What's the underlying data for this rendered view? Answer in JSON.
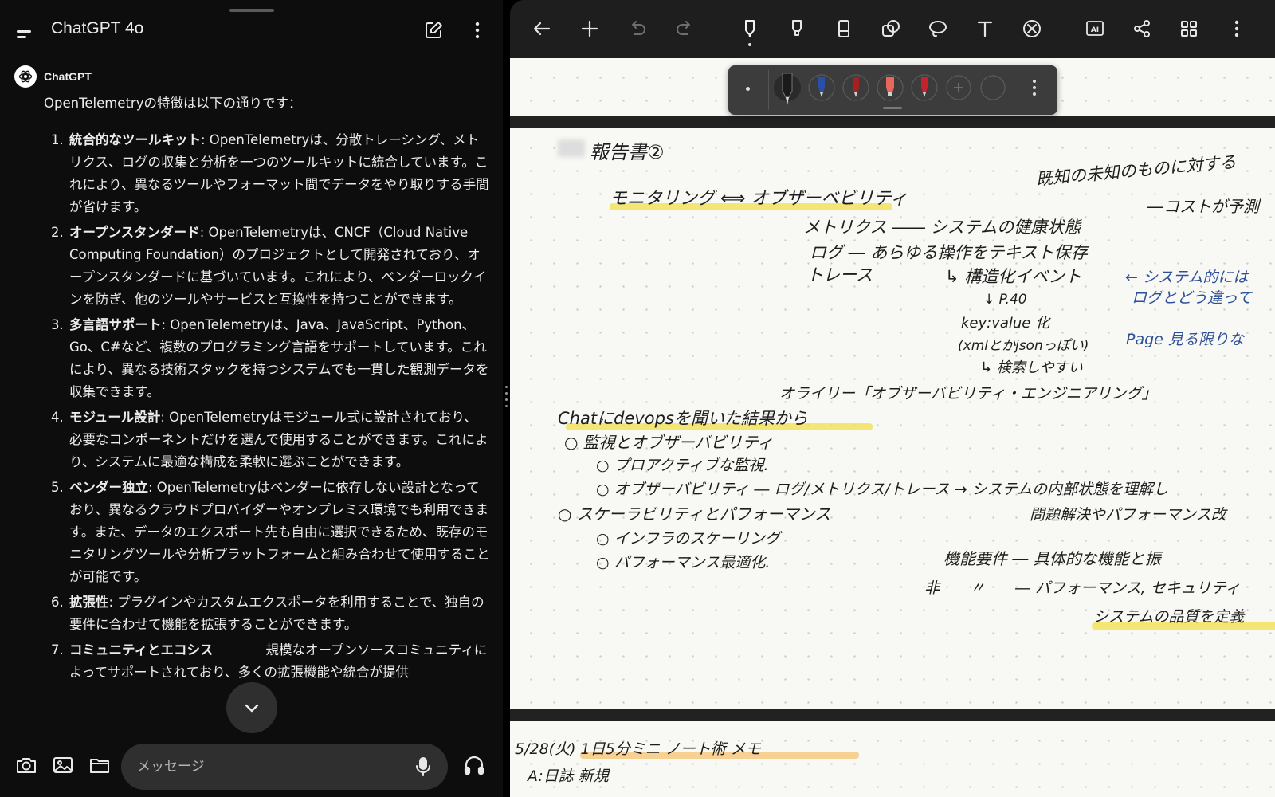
{
  "chat": {
    "title": "ChatGPT 4o",
    "assistant_name": "ChatGPT",
    "intro": "OpenTelemetryの特徴は以下の通りです：",
    "features": [
      {
        "num": "1.",
        "title": "統合的なツールキット",
        "text": ": OpenTelemetryは、分散トレーシング、メトリクス、ログの収集と分析を一つのツールキットに統合しています。これにより、異なるツールやフォーマット間でデータをやり取りする手間が省けます。"
      },
      {
        "num": "2.",
        "title": "オープンスタンダード",
        "text": ": OpenTelemetryは、CNCF（Cloud Native Computing Foundation）のプロジェクトとして開発されており、オープンスタンダードに基づいています。これにより、ベンダーロックインを防ぎ、他のツールやサービスと互換性を持つことができます。"
      },
      {
        "num": "3.",
        "title": "多言語サポート",
        "text": ": OpenTelemetryは、Java、JavaScript、Python、Go、C#など、複数のプログラミング言語をサポートしています。これにより、異なる技術スタックを持つシステムでも一貫した観測データを収集できます。"
      },
      {
        "num": "4.",
        "title": "モジュール設計",
        "text": ": OpenTelemetryはモジュール式に設計されており、必要なコンポーネントだけを選んで使用することができます。これにより、システムに最適な構成を柔軟に選ぶことができます。"
      },
      {
        "num": "5.",
        "title": "ベンダー独立",
        "text": ": OpenTelemetryはベンダーに依存しない設計となっており、異なるクラウドプロバイダーやオンプレミス環境でも利用できます。また、データのエクスポート先も自由に選択できるため、既存のモニタリングツールや分析プラットフォームと組み合わせて使用することが可能です。"
      },
      {
        "num": "6.",
        "title": "拡張性",
        "text": ": プラグインやカスタムエクスポータを利用することで、独自の要件に合わせて機能を拡張することができます。"
      },
      {
        "num": "7.",
        "title": "コミュニティとエコシス",
        "text": "　　　　規模なオープンソースコミュニティによってサポートされており、多くの拡張機能や統合が提供"
      }
    ],
    "input_placeholder": "メッセージ"
  },
  "notes": {
    "pen_colors": [
      "#1a1a1a",
      "#2a4fa8",
      "#a81f1f",
      "#e8665a",
      "#c4232c"
    ],
    "highlight_color": "#f2e04a",
    "highlight_color_2": "#f5c77a",
    "page2": {
      "title": "報告書②",
      "line_monitoring": "モニタリング ⟺ オブザーベビリティ",
      "line_known": "既知の未知のものに対する",
      "line_metrics": "メトリクス ―― システムの健康状態",
      "line_cost": "―コストが予測",
      "line_log": "ログ ― あらゆる操作をテキスト保存",
      "line_trace": "トレース",
      "line_struct": "↳ 構造化イベント",
      "blue_system": "← システム的には",
      "blue_log": "ログとどう違って",
      "line_p40": "↓ P.40",
      "line_keyvalue": "key:value 化",
      "line_xml": "(xmlとかjsonっぽい)",
      "blue_page": "Page 見る限りな",
      "line_search": "↳ 検索しやすい",
      "line_oreilly": "オライリー「オブザーバビリティ・エンジニアリング」",
      "line_chat": "Chatにdevopsを聞いた結果から",
      "line_b1": "○ 監視とオブザーバビリティ",
      "line_b1a": "○ プロアクティブな監視.",
      "line_b1b": "○ オブザーバビリティ ― ログ/メトリクス/トレース → システムの内部状態を理解し",
      "line_b2": "○ スケーラビリティとパフォーマンス",
      "line_b2r": "問題解決やパフォーマンス改",
      "line_b2a": "○ インフラのスケーリング",
      "line_b2b": "○ パフォーマンス最適化.",
      "line_func": "機能要件 ― 具体的な機能と振",
      "line_nonfunc": "非　　〃　　― パフォーマンス, セキュリティ",
      "line_quality": "システムの品質を定義"
    },
    "page3": {
      "line_1": "5/28(火) 1日5分ミニ ノート術 メモ",
      "line_2": "A:日誌 新規"
    }
  }
}
